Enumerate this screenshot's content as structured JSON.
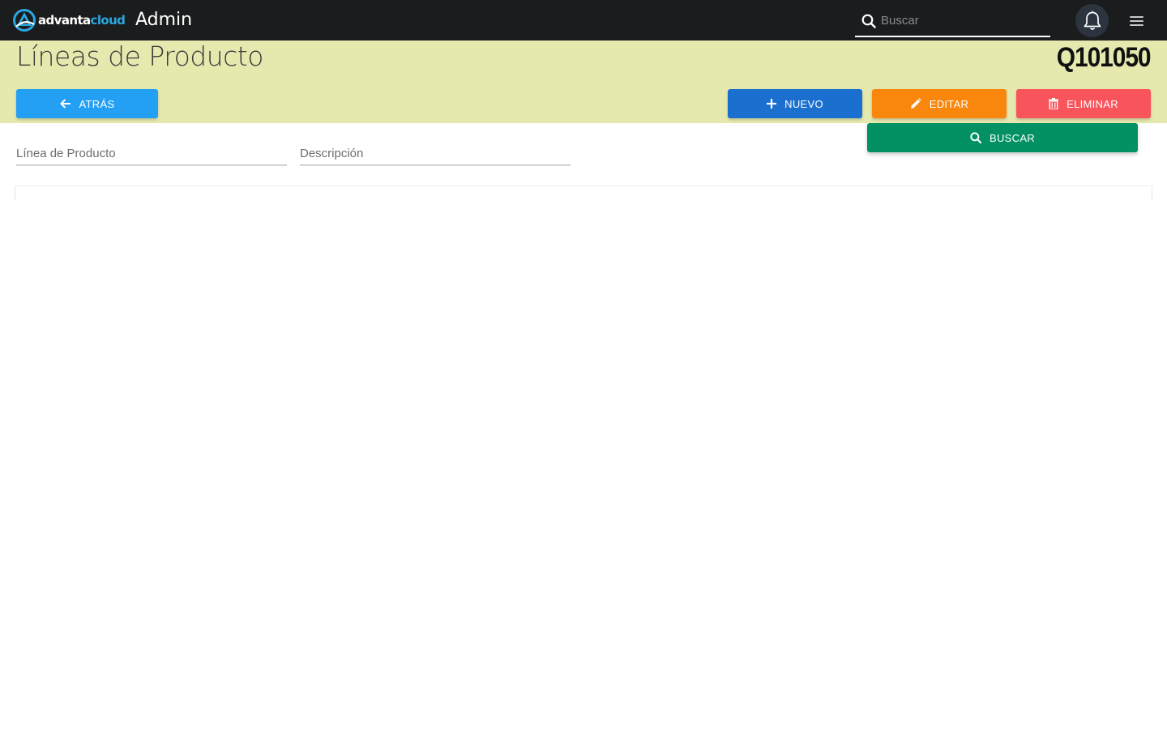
{
  "navbar": {
    "brand_part1": "advanta",
    "brand_part2": "cloud",
    "app_title": "Admin",
    "search_placeholder": "Buscar"
  },
  "header": {
    "title": "Líneas de Producto",
    "code": "Q101050"
  },
  "toolbar": {
    "back_label": "ATRÁS",
    "new_label": "NUEVO",
    "edit_label": "EDITAR",
    "delete_label": "ELIMINAR",
    "search_label": "BUSCAR"
  },
  "filters": {
    "product_line_placeholder": "Línea de Producto",
    "description_placeholder": "Descripción"
  },
  "colors": {
    "navbar_bg": "#1b1c1e",
    "header_bg": "#e6e9ae",
    "back": "#23a0f4",
    "new": "#1b6fcf",
    "edit": "#f9870e",
    "delete": "#f8545c",
    "search": "#039164",
    "brand_accent": "#29a8e0"
  }
}
